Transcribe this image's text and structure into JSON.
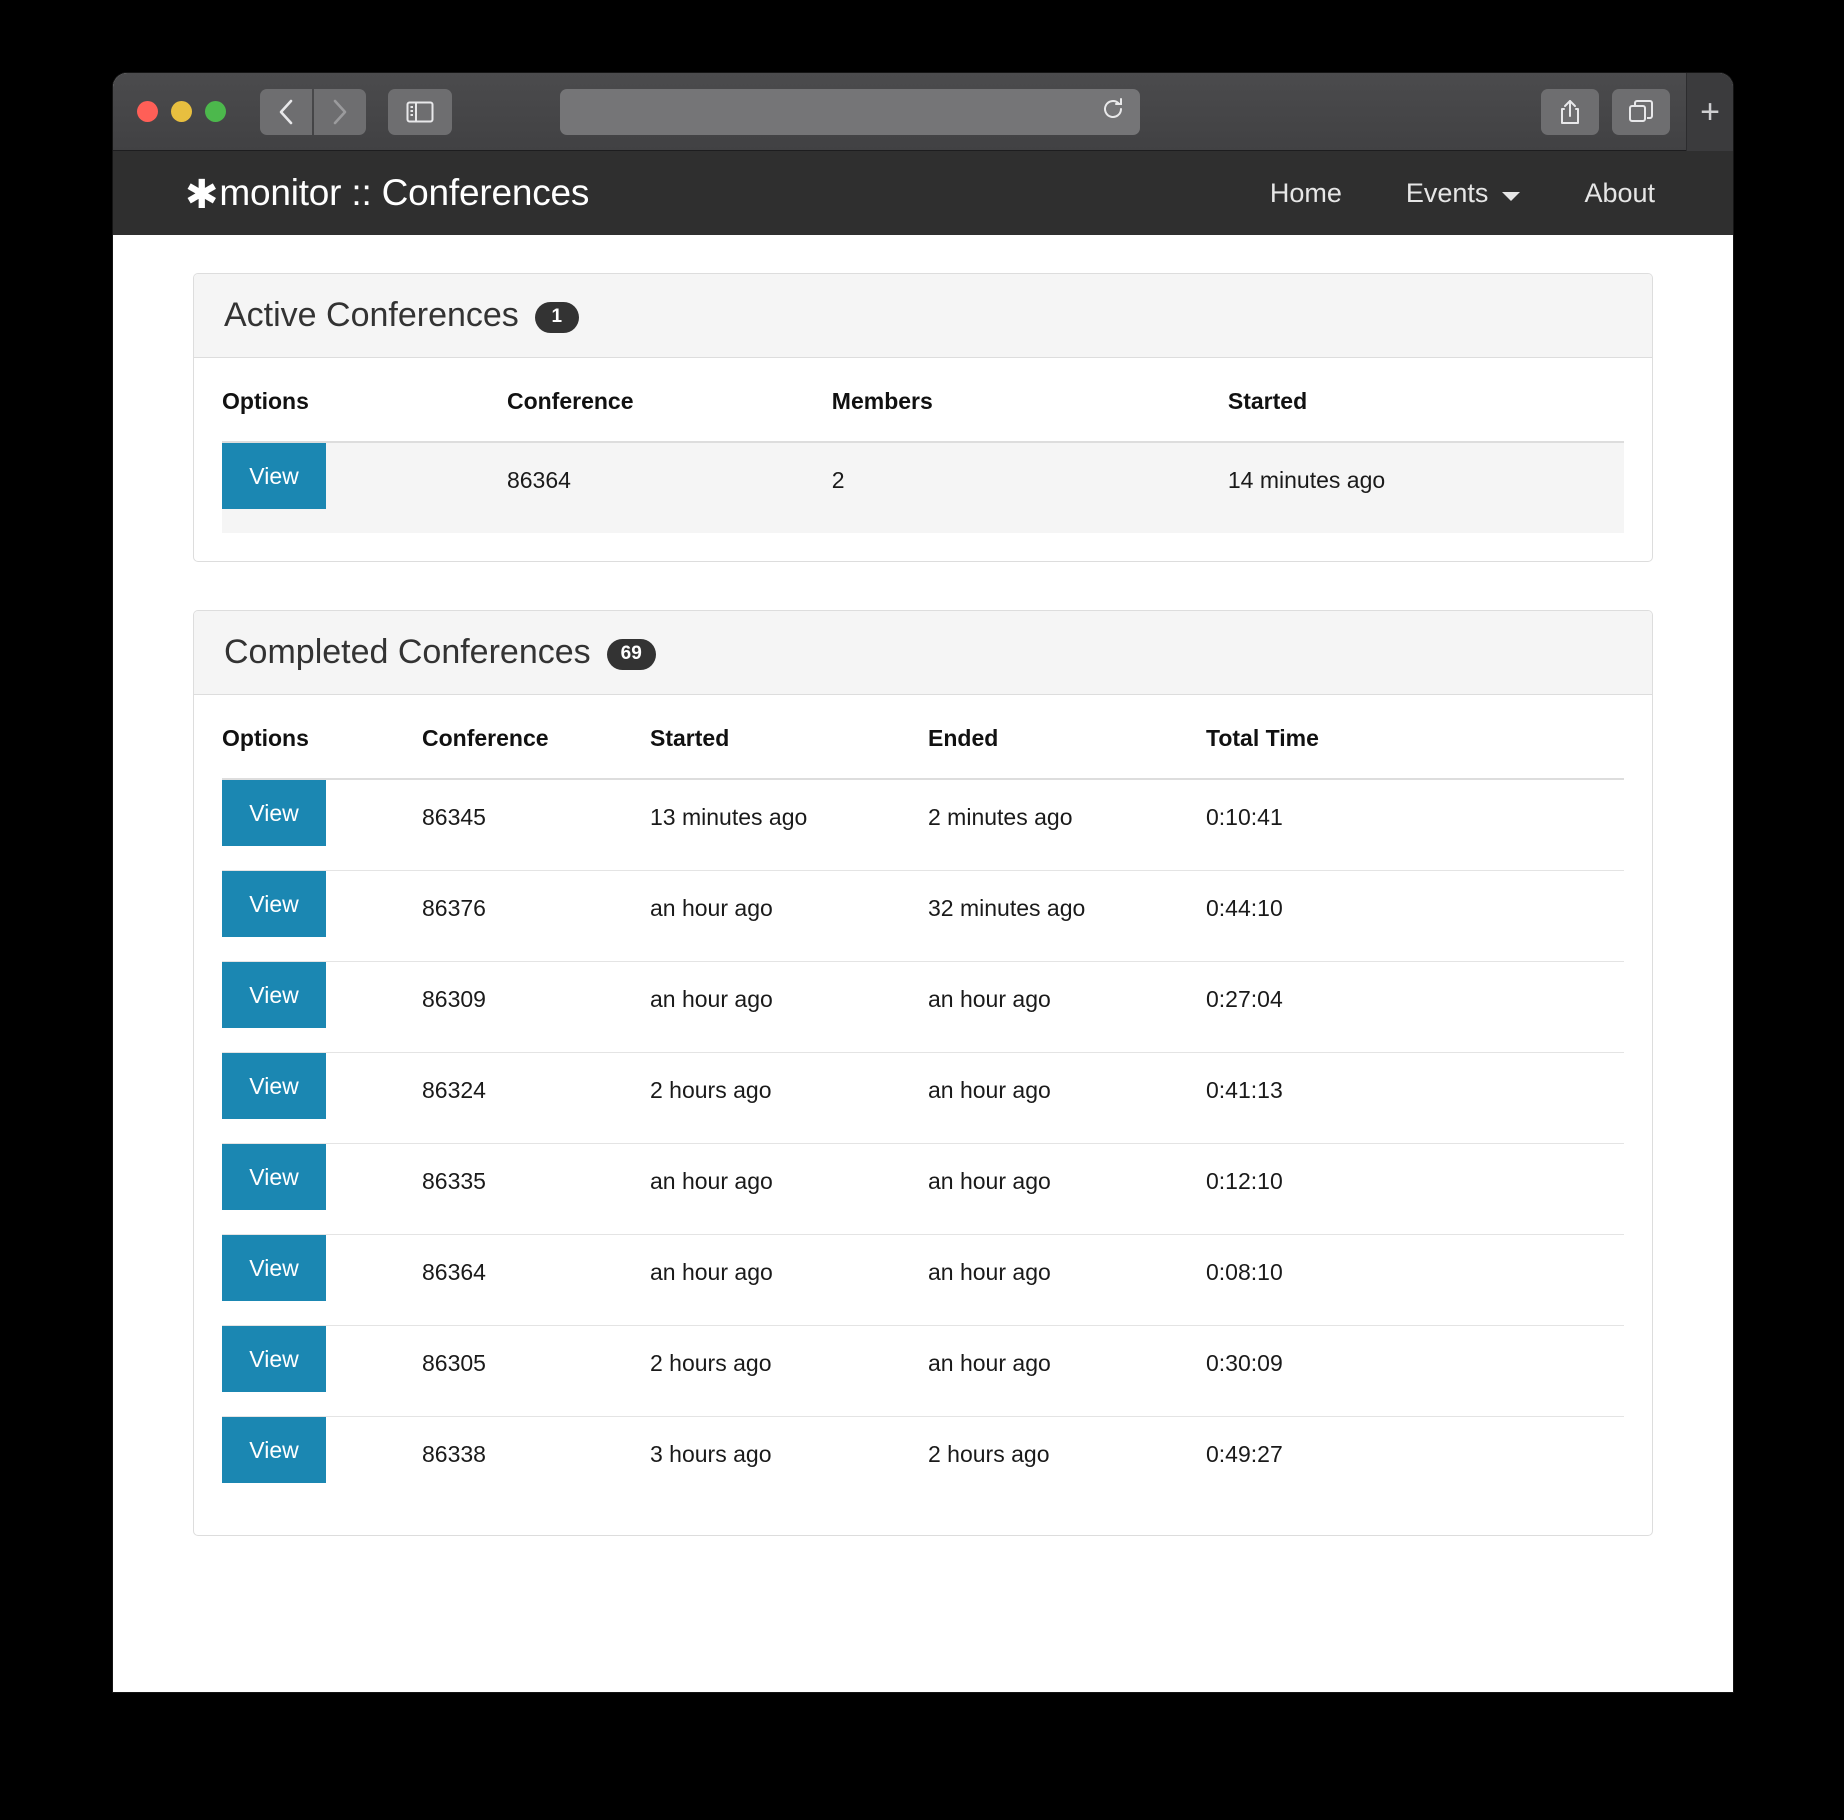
{
  "browser": {
    "traffic_lights": [
      "close",
      "minimize",
      "zoom"
    ],
    "back_label": "Back",
    "forward_label": "Forward",
    "sidebar_label": "Show Sidebar",
    "url_value": "",
    "url_placeholder": "",
    "reload_label": "Reload",
    "share_label": "Share",
    "tabs_label": "Show Tab Overview",
    "new_tab_label": "+"
  },
  "site": {
    "logo_glyph": "✱",
    "brand": "monitor :: Conferences",
    "nav": [
      {
        "label": "Home",
        "has_caret": false
      },
      {
        "label": "Events",
        "has_caret": true
      },
      {
        "label": "About",
        "has_caret": false
      }
    ]
  },
  "colors": {
    "accent_button": "#1b87b2",
    "header_bg": "#2f2f2f",
    "badge_bg": "#333333",
    "panel_heading_bg": "#f5f5f5",
    "panel_border": "#dddddd"
  },
  "active_panel": {
    "title": "Active Conferences",
    "badge": "1",
    "columns": [
      "Options",
      "Conference",
      "Members",
      "Started"
    ],
    "rows": [
      {
        "action": "View",
        "conference": "86364",
        "members": "2",
        "started": "14 minutes ago"
      }
    ]
  },
  "completed_panel": {
    "title": "Completed Conferences",
    "badge": "69",
    "columns": [
      "Options",
      "Conference",
      "Started",
      "Ended",
      "Total Time"
    ],
    "rows": [
      {
        "action": "View",
        "conference": "86345",
        "started": "13 minutes ago",
        "ended": "2 minutes ago",
        "total_time": "0:10:41"
      },
      {
        "action": "View",
        "conference": "86376",
        "started": "an hour ago",
        "ended": "32 minutes ago",
        "total_time": "0:44:10"
      },
      {
        "action": "View",
        "conference": "86309",
        "started": "an hour ago",
        "ended": "an hour ago",
        "total_time": "0:27:04"
      },
      {
        "action": "View",
        "conference": "86324",
        "started": "2 hours ago",
        "ended": "an hour ago",
        "total_time": "0:41:13"
      },
      {
        "action": "View",
        "conference": "86335",
        "started": "an hour ago",
        "ended": "an hour ago",
        "total_time": "0:12:10"
      },
      {
        "action": "View",
        "conference": "86364",
        "started": "an hour ago",
        "ended": "an hour ago",
        "total_time": "0:08:10"
      },
      {
        "action": "View",
        "conference": "86305",
        "started": "2 hours ago",
        "ended": "an hour ago",
        "total_time": "0:30:09"
      },
      {
        "action": "View",
        "conference": "86338",
        "started": "3 hours ago",
        "ended": "2 hours ago",
        "total_time": "0:49:27"
      }
    ]
  }
}
